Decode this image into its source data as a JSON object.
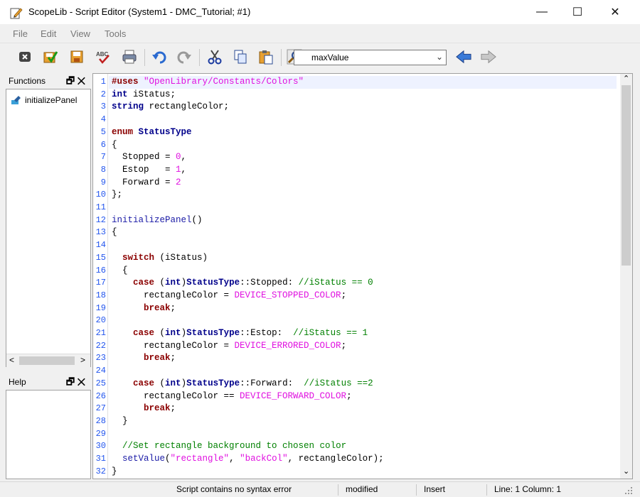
{
  "window": {
    "title": "ScopeLib - Script Editor (System1 - DMC_Tutorial; #1)",
    "minimize": "—",
    "maximize": "☐",
    "close": "✕"
  },
  "menu": [
    "File",
    "Edit",
    "View",
    "Tools"
  ],
  "toolbar": {
    "search_value": "maxValue",
    "icons": [
      "close-script-icon",
      "apply-icon",
      "save-icon",
      "spellcheck-icon",
      "print-icon",
      "undo-icon",
      "redo-icon",
      "cut-icon",
      "copy-icon",
      "paste-icon",
      "find-icon",
      "nav-back-icon",
      "nav-forward-icon"
    ]
  },
  "functions_panel": {
    "title": "Functions",
    "items": [
      "initializePanel"
    ]
  },
  "help_panel": {
    "title": "Help"
  },
  "editor": {
    "lines": [
      {
        "n": "1",
        "segs": [
          {
            "c": "kw",
            "t": "#uses "
          },
          {
            "c": "m",
            "t": "\"OpenLibrary/Constants/Colors\""
          }
        ]
      },
      {
        "n": "2",
        "segs": [
          {
            "c": "k",
            "t": "int"
          },
          {
            "c": "",
            "t": " iStatus;"
          }
        ]
      },
      {
        "n": "3",
        "segs": [
          {
            "c": "k",
            "t": "string"
          },
          {
            "c": "",
            "t": " rectangleColor;"
          }
        ]
      },
      {
        "n": "4",
        "segs": []
      },
      {
        "n": "5",
        "segs": [
          {
            "c": "kw",
            "t": "enum"
          },
          {
            "c": "",
            "t": " "
          },
          {
            "c": "k",
            "t": "StatusType"
          }
        ]
      },
      {
        "n": "6",
        "segs": [
          {
            "c": "",
            "t": "{"
          }
        ]
      },
      {
        "n": "7",
        "segs": [
          {
            "c": "",
            "t": "  Stopped = "
          },
          {
            "c": "m",
            "t": "0"
          },
          {
            "c": "",
            "t": ","
          }
        ]
      },
      {
        "n": "8",
        "segs": [
          {
            "c": "",
            "t": "  Estop   = "
          },
          {
            "c": "m",
            "t": "1"
          },
          {
            "c": "",
            "t": ","
          }
        ]
      },
      {
        "n": "9",
        "segs": [
          {
            "c": "",
            "t": "  Forward = "
          },
          {
            "c": "m",
            "t": "2"
          }
        ]
      },
      {
        "n": "10",
        "segs": [
          {
            "c": "",
            "t": "};"
          }
        ]
      },
      {
        "n": "11",
        "segs": []
      },
      {
        "n": "12",
        "segs": [
          {
            "c": "t",
            "t": "initializePanel"
          },
          {
            "c": "",
            "t": "()"
          }
        ]
      },
      {
        "n": "13",
        "segs": [
          {
            "c": "",
            "t": "{"
          }
        ]
      },
      {
        "n": "14",
        "segs": []
      },
      {
        "n": "15",
        "segs": [
          {
            "c": "",
            "t": "  "
          },
          {
            "c": "kw",
            "t": "switch"
          },
          {
            "c": "",
            "t": " (iStatus)"
          }
        ]
      },
      {
        "n": "16",
        "segs": [
          {
            "c": "",
            "t": "  {"
          }
        ]
      },
      {
        "n": "17",
        "segs": [
          {
            "c": "",
            "t": "    "
          },
          {
            "c": "kw",
            "t": "case"
          },
          {
            "c": "",
            "t": " ("
          },
          {
            "c": "k",
            "t": "int"
          },
          {
            "c": "",
            "t": ")"
          },
          {
            "c": "k",
            "t": "StatusType"
          },
          {
            "c": "",
            "t": "::Stopped: "
          },
          {
            "c": "c",
            "t": "//iStatus == 0"
          }
        ]
      },
      {
        "n": "18",
        "segs": [
          {
            "c": "",
            "t": "      rectangleColor = "
          },
          {
            "c": "m",
            "t": "DEVICE_STOPPED_COLOR"
          },
          {
            "c": "",
            "t": ";"
          }
        ]
      },
      {
        "n": "19",
        "segs": [
          {
            "c": "",
            "t": "      "
          },
          {
            "c": "kw",
            "t": "break"
          },
          {
            "c": "",
            "t": ";"
          }
        ]
      },
      {
        "n": "20",
        "segs": []
      },
      {
        "n": "21",
        "segs": [
          {
            "c": "",
            "t": "    "
          },
          {
            "c": "kw",
            "t": "case"
          },
          {
            "c": "",
            "t": " ("
          },
          {
            "c": "k",
            "t": "int"
          },
          {
            "c": "",
            "t": ")"
          },
          {
            "c": "k",
            "t": "StatusType"
          },
          {
            "c": "",
            "t": "::Estop:  "
          },
          {
            "c": "c",
            "t": "//iStatus == 1"
          }
        ]
      },
      {
        "n": "22",
        "segs": [
          {
            "c": "",
            "t": "      rectangleColor = "
          },
          {
            "c": "m",
            "t": "DEVICE_ERRORED_COLOR"
          },
          {
            "c": "",
            "t": ";"
          }
        ]
      },
      {
        "n": "23",
        "segs": [
          {
            "c": "",
            "t": "      "
          },
          {
            "c": "kw",
            "t": "break"
          },
          {
            "c": "",
            "t": ";"
          }
        ]
      },
      {
        "n": "24",
        "segs": []
      },
      {
        "n": "25",
        "segs": [
          {
            "c": "",
            "t": "    "
          },
          {
            "c": "kw",
            "t": "case"
          },
          {
            "c": "",
            "t": " ("
          },
          {
            "c": "k",
            "t": "int"
          },
          {
            "c": "",
            "t": ")"
          },
          {
            "c": "k",
            "t": "StatusType"
          },
          {
            "c": "",
            "t": "::Forward:  "
          },
          {
            "c": "c",
            "t": "//iStatus ==2"
          }
        ]
      },
      {
        "n": "26",
        "segs": [
          {
            "c": "",
            "t": "      rectangleColor == "
          },
          {
            "c": "m",
            "t": "DEVICE_FORWARD_COLOR"
          },
          {
            "c": "",
            "t": ";"
          }
        ]
      },
      {
        "n": "27",
        "segs": [
          {
            "c": "",
            "t": "      "
          },
          {
            "c": "kw",
            "t": "break"
          },
          {
            "c": "",
            "t": ";"
          }
        ]
      },
      {
        "n": "28",
        "segs": [
          {
            "c": "",
            "t": "  }"
          }
        ]
      },
      {
        "n": "29",
        "segs": []
      },
      {
        "n": "30",
        "segs": [
          {
            "c": "",
            "t": "  "
          },
          {
            "c": "c",
            "t": "//Set rectangle background to chosen color"
          }
        ]
      },
      {
        "n": "31",
        "segs": [
          {
            "c": "",
            "t": "  "
          },
          {
            "c": "t",
            "t": "setValue"
          },
          {
            "c": "",
            "t": "("
          },
          {
            "c": "m",
            "t": "\"rectangle\""
          },
          {
            "c": "",
            "t": ", "
          },
          {
            "c": "m",
            "t": "\"backCol\""
          },
          {
            "c": "",
            "t": ", rectangleColor);"
          }
        ]
      },
      {
        "n": "32",
        "segs": [
          {
            "c": "",
            "t": "}"
          }
        ]
      }
    ]
  },
  "status": {
    "syntax": "Script contains no syntax error",
    "modified": "modified",
    "mode": "Insert",
    "position": "Line: 1 Column: 1"
  }
}
